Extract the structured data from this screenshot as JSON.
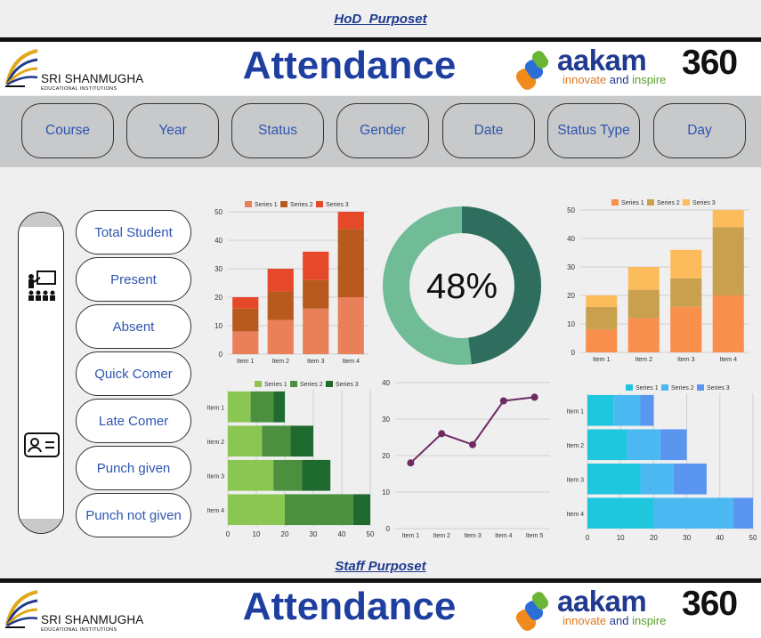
{
  "top_link": "HoD_Purposet",
  "mid_link": "Staff Purposet",
  "header": {
    "logo_line1": "SRI SHANMUGHA",
    "logo_line2": "EDUCATIONAL INSTITUTIONS",
    "title": "Attendance",
    "brand_word": "aakam",
    "brand_num": "360",
    "tag1": "innovate",
    "tag2": " and ",
    "tag3": "inspire"
  },
  "filters": [
    "Course",
    "Year",
    "Status",
    "Gender",
    "Date",
    "Status Type",
    "Day"
  ],
  "side_icons": [
    "presentation-icon",
    "id-card-icon"
  ],
  "metrics": [
    "Total Student",
    "Present",
    "Absent",
    "Quick Comer",
    "Late Comer",
    "Punch given",
    "Punch not given"
  ],
  "donut": {
    "value": 48,
    "label": "48%",
    "colors": [
      "#2f6e5e",
      "#6fbc97"
    ]
  },
  "chart_data": [
    {
      "id": "col1",
      "type": "bar",
      "stacked": true,
      "orientation": "vertical",
      "categories": [
        "Item 1",
        "Item 2",
        "Item 3",
        "Item 4"
      ],
      "ylim": [
        0,
        50
      ],
      "yticks": [
        0,
        10,
        20,
        30,
        40,
        50
      ],
      "legend": "top",
      "grid": true,
      "series": [
        {
          "name": "Series 1",
          "values": [
            8,
            12,
            16,
            20
          ],
          "color": "#e9805a"
        },
        {
          "name": "Series 2",
          "values": [
            8,
            10,
            10,
            24
          ],
          "color": "#b85a1e"
        },
        {
          "name": "Series 3",
          "values": [
            4,
            8,
            10,
            6
          ],
          "color": "#e6482a"
        }
      ]
    },
    {
      "id": "col2",
      "type": "bar",
      "stacked": true,
      "orientation": "vertical",
      "categories": [
        "Item 1",
        "Item 2",
        "Item 3",
        "Item 4"
      ],
      "ylim": [
        0,
        50
      ],
      "yticks": [
        0,
        10,
        20,
        30,
        40,
        50
      ],
      "legend": "top",
      "grid": true,
      "series": [
        {
          "name": "Series 1",
          "values": [
            8,
            12,
            16,
            20
          ],
          "color": "#f98f4c"
        },
        {
          "name": "Series 2",
          "values": [
            8,
            10,
            10,
            24
          ],
          "color": "#c9a04e"
        },
        {
          "name": "Series 3",
          "values": [
            4,
            8,
            10,
            6
          ],
          "color": "#fdbc5c"
        }
      ]
    },
    {
      "id": "hbar1",
      "type": "bar",
      "stacked": true,
      "orientation": "horizontal",
      "categories": [
        "Item 1",
        "Item 2",
        "Item 3",
        "Item 4"
      ],
      "xlim": [
        0,
        50
      ],
      "xticks": [
        0,
        10,
        20,
        30,
        40,
        50
      ],
      "legend": "top",
      "grid": true,
      "series": [
        {
          "name": "Series 1",
          "values": [
            8,
            12,
            16,
            20
          ],
          "color": "#8bc653"
        },
        {
          "name": "Series 2",
          "values": [
            8,
            10,
            10,
            24
          ],
          "color": "#4c8f3f"
        },
        {
          "name": "Series 3",
          "values": [
            4,
            8,
            10,
            6
          ],
          "color": "#1f6a2e"
        }
      ]
    },
    {
      "id": "line1",
      "type": "line",
      "categories": [
        "Item 1",
        "Item 2",
        "Item 3",
        "Item 4",
        "Item 5"
      ],
      "values": [
        18,
        26,
        23,
        35,
        36
      ],
      "ylim": [
        0,
        40
      ],
      "yticks": [
        0,
        10,
        20,
        30,
        40
      ],
      "grid": true,
      "color": "#6e2a63"
    },
    {
      "id": "hbar2",
      "type": "bar",
      "stacked": true,
      "orientation": "horizontal",
      "categories": [
        "Item 1",
        "Item 2",
        "Item 3",
        "Item 4"
      ],
      "xlim": [
        0,
        50
      ],
      "xticks": [
        0,
        10,
        20,
        30,
        40,
        50
      ],
      "legend": "top",
      "grid": true,
      "series": [
        {
          "name": "Series 1",
          "values": [
            8,
            12,
            16,
            20
          ],
          "color": "#1ec6de"
        },
        {
          "name": "Series 2",
          "values": [
            8,
            10,
            10,
            24
          ],
          "color": "#4cb8f2"
        },
        {
          "name": "Series 3",
          "values": [
            4,
            8,
            10,
            6
          ],
          "color": "#5a96f0"
        }
      ]
    }
  ]
}
